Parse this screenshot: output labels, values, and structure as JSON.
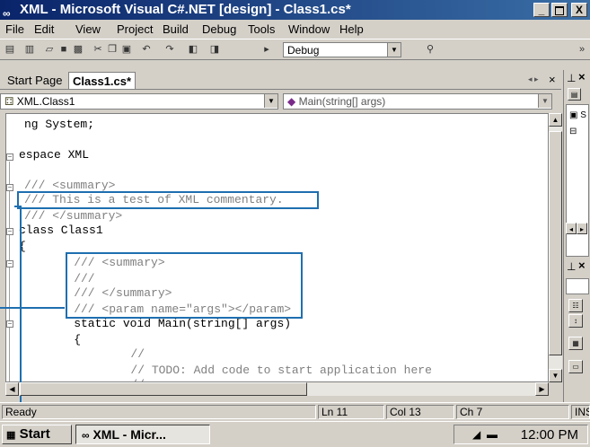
{
  "window": {
    "title": "XML - Microsoft Visual C#.NET [design] - Class1.cs*",
    "buttons": [
      "_",
      " ",
      "X"
    ]
  },
  "menu": [
    "File",
    "Edit",
    "View",
    "Project",
    "Build",
    "Debug",
    "Tools",
    "Window",
    "Help"
  ],
  "toolbar": {
    "config": "Debug",
    "overflow": "»"
  },
  "tabs": {
    "start_page": "Start Page",
    "class1": "Class1.cs*",
    "close": "×"
  },
  "nav": {
    "class_combo": "XML.Class1",
    "member_combo": "Main(string[] args)"
  },
  "code_lines": [
    "ng System;",
    "",
    "espace XML",
    "",
    "/// <summary>",
    "/// This is a test of XML commentary.",
    "/// </summary>",
    "class Class1",
    "{",
    "    /// <summary>",
    "    ///",
    "    /// </summary>",
    "    /// <param name=\"args\"></param>",
    "    static void Main(string[] args)",
    "    {",
    "        //",
    "        // TODO: Add code to start application here",
    "        //"
  ],
  "status": {
    "ready": "Ready",
    "ln": "Ln 11",
    "col": "Col 13",
    "ch": "Ch 7",
    "ins": "INS"
  },
  "taskbar": {
    "start": "Start",
    "task": "XML - Micr...",
    "clock": "12:00 PM"
  },
  "right_panel": {
    "close1": "×",
    "close2": "×"
  }
}
